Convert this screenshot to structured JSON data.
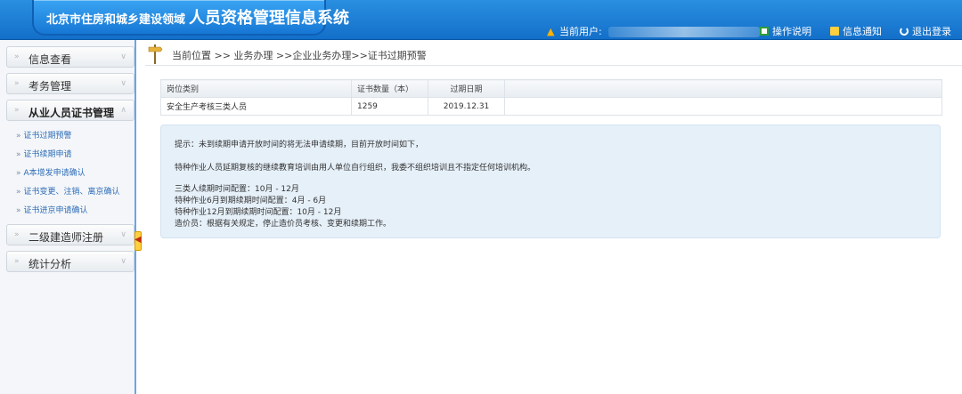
{
  "header": {
    "logo_small": "北京市住房和城乡建设领域",
    "logo_big": "人员资格管理信息系统",
    "current_user_label": "当前用户:",
    "links": [
      {
        "label": "操作说明",
        "icon": "guide-icon"
      },
      {
        "label": "信息通知",
        "icon": "mail-icon"
      },
      {
        "label": "退出登录",
        "icon": "power-icon"
      }
    ]
  },
  "sidebar": {
    "menus": [
      {
        "label": "信息查看"
      },
      {
        "label": "考务管理"
      },
      {
        "label": "从业人员证书管理",
        "active": true
      },
      {
        "label": "二级建造师注册"
      },
      {
        "label": "统计分析"
      }
    ],
    "subitems": [
      {
        "label": "证书过期预警"
      },
      {
        "label": "证书续期申请"
      },
      {
        "label": "A本增发申请确认"
      },
      {
        "label": "证书变更、注销、离京确认"
      },
      {
        "label": "证书进京申请确认"
      }
    ]
  },
  "breadcrumb": {
    "text": "当前位置 >> 业务办理 >>企业业务办理>>证书过期预警"
  },
  "table": {
    "headers": [
      "岗位类别",
      "证书数量（本）",
      "过期日期"
    ],
    "rows": [
      [
        "安全生产考核三类人员",
        "1259",
        "2019.12.31"
      ]
    ]
  },
  "notice": {
    "lines": [
      "提示：未到续期申请开放时间的将无法申请续期，目前开放时间如下，",
      "特种作业人员延期复核的继续教育培训由用人单位自行组织，我委不组织培训且不指定任何培训机构。",
      "三类人续期时间配置：10月 - 12月",
      "特种作业6月到期续期时间配置：4月 - 6月",
      "特种作业12月到期续期时间配置：10月 - 12月",
      "造价员：根据有关规定，停止造价员考核、变更和续期工作。"
    ]
  },
  "colors": {
    "header_blue": "#1a7bd6",
    "link_blue": "#2e6db8",
    "notice_bg": "#e6f0f9"
  }
}
